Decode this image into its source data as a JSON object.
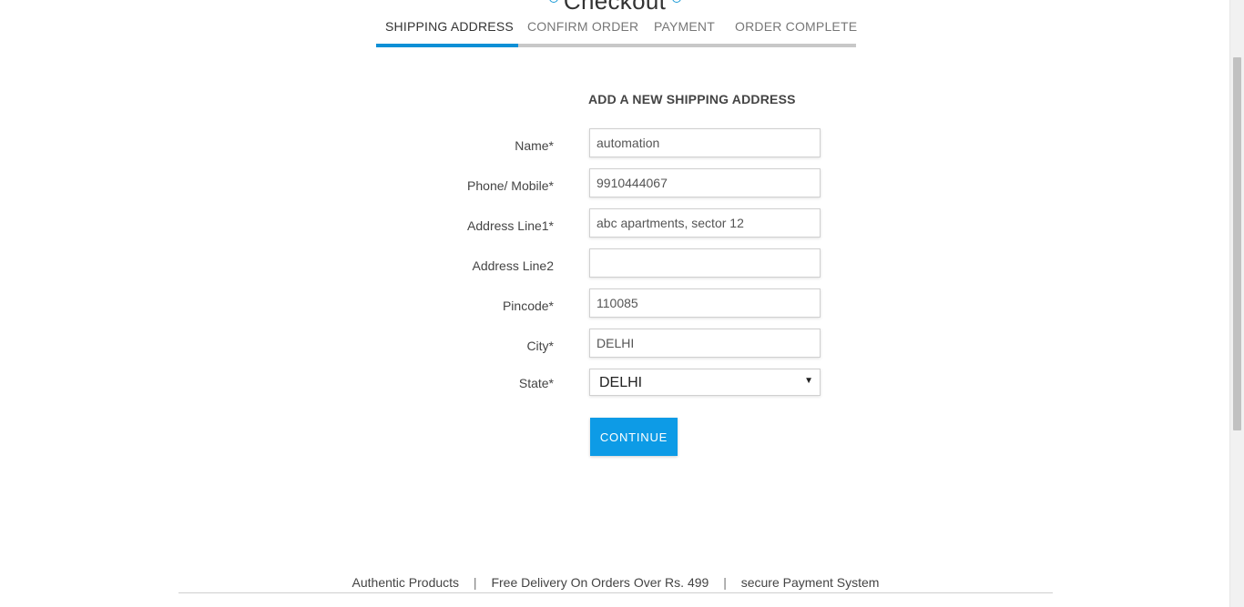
{
  "header": {
    "title": "Checkout"
  },
  "steps": [
    {
      "label": "SHIPPING ADDRESS",
      "active": true
    },
    {
      "label": "CONFIRM ORDER",
      "active": false
    },
    {
      "label": "PAYMENT",
      "active": false
    },
    {
      "label": "ORDER COMPLETE",
      "active": false
    }
  ],
  "form": {
    "heading": "ADD A NEW SHIPPING ADDRESS",
    "fields": {
      "name": {
        "label": "Name*",
        "value": "automation"
      },
      "phone": {
        "label": "Phone/ Mobile*",
        "value": "9910444067"
      },
      "address1": {
        "label": "Address Line1*",
        "value": "abc apartments, sector 12"
      },
      "address2": {
        "label": "Address Line2",
        "value": ""
      },
      "pincode": {
        "label": "Pincode*",
        "value": "110085"
      },
      "city": {
        "label": "City*",
        "value": "DELHI"
      },
      "state": {
        "label": "State*",
        "value": "DELHI"
      }
    },
    "continue_label": "CONTINUE"
  },
  "footer": {
    "items": [
      "Authentic Products",
      "Free Delivery On Orders Over Rs. 499",
      "secure Payment System"
    ],
    "separator": "|"
  },
  "colors": {
    "accent": "#0d9be6",
    "active_step_bar": "#0d8fd6"
  },
  "icons": {
    "dropdown": "triangle-down-icon",
    "title_decoration": "circle-icon"
  }
}
